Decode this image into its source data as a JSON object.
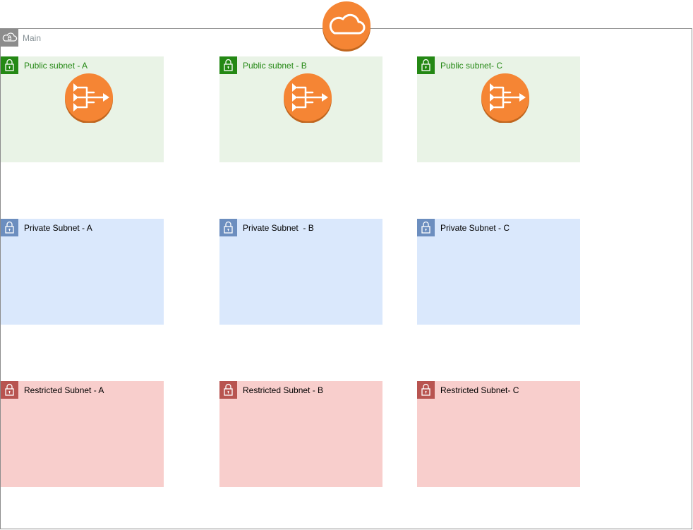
{
  "vpc": {
    "label": "Main"
  },
  "subnets": {
    "public": [
      {
        "label": "Public subnet - A"
      },
      {
        "label": "Public subnet - B"
      },
      {
        "label": "Public subnet- C"
      }
    ],
    "private": [
      {
        "label": "Private Subnet - A"
      },
      {
        "label": "Private Subnet  - B"
      },
      {
        "label": "Private Subnet - C"
      }
    ],
    "restricted": [
      {
        "label": "Restricted Subnet - A"
      },
      {
        "label": "Restricted Subnet - B"
      },
      {
        "label": "Restricted Subnet- C"
      }
    ]
  },
  "icons": {
    "vpc": "vpc-cloud-lock-icon",
    "subnet": "padlock-icon",
    "nat": "nat-gateway-icon",
    "igw": "internet-gateway-cloud-icon"
  },
  "colors": {
    "public_fill": "#e9f3e6",
    "public_accent": "#248814",
    "private_fill": "#dae8fc",
    "private_accent": "#6c8ebf",
    "restricted_fill": "#f8cecc",
    "restricted_accent": "#b85450",
    "aws_orange": "#f58534",
    "aws_orange_dark": "#c0661f"
  }
}
